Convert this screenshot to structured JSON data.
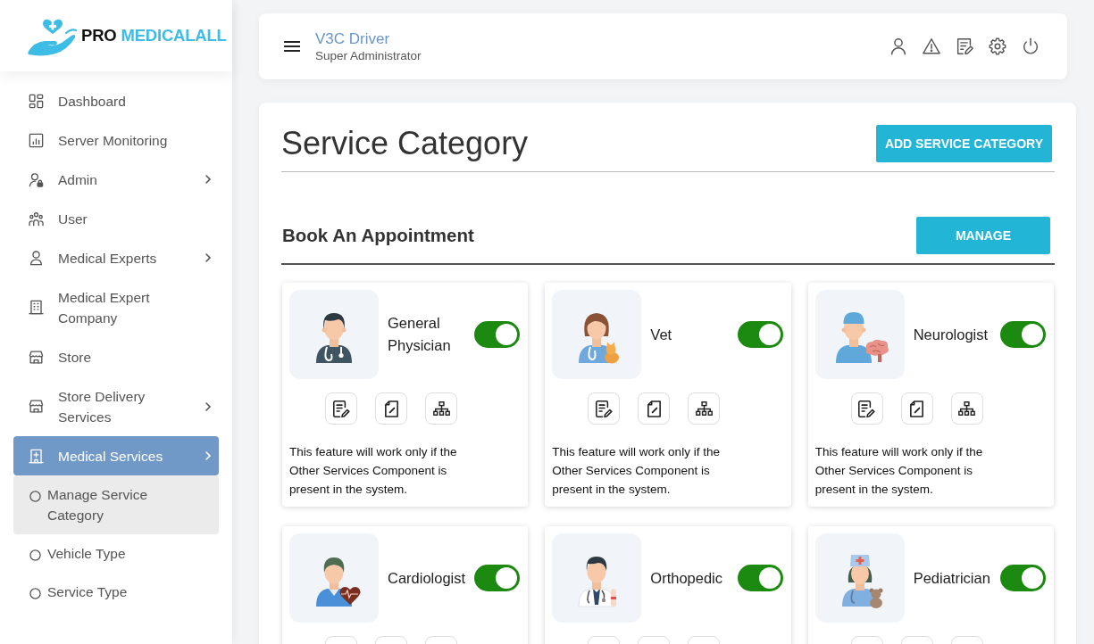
{
  "brand": {
    "prefix": "PRO",
    "name": "MEDICALALL"
  },
  "sidebar": {
    "items": [
      {
        "label": "Dashboard",
        "expandable": false,
        "selected": false
      },
      {
        "label": "Server Monitoring",
        "expandable": false,
        "selected": false
      },
      {
        "label": "Admin",
        "expandable": true,
        "selected": false
      },
      {
        "label": "User",
        "expandable": false,
        "selected": false
      },
      {
        "label": "Medical Experts",
        "expandable": true,
        "selected": false
      },
      {
        "label": "Medical Expert Company",
        "expandable": false,
        "selected": false
      },
      {
        "label": "Store",
        "expandable": false,
        "selected": false
      },
      {
        "label": "Store Delivery Services",
        "expandable": true,
        "selected": false
      },
      {
        "label": "Medical Services",
        "expandable": true,
        "selected": true,
        "children": [
          {
            "label": "Manage Service Category",
            "selected": true
          },
          {
            "label": "Vehicle Type",
            "selected": false
          },
          {
            "label": "Service Type",
            "selected": false
          }
        ]
      }
    ]
  },
  "header": {
    "user_name": "V3C Driver",
    "role": "Super Administrator"
  },
  "page": {
    "title": "Service Category",
    "add_button": "ADD SERVICE CATEGORY"
  },
  "section": {
    "title": "Book An Appointment",
    "manage_button": "MANAGE",
    "cards": [
      {
        "name": "General Physician",
        "on": true,
        "note": "This feature will work only if the Other Services Component is present in the system."
      },
      {
        "name": "Vet",
        "on": true,
        "note": "This feature will work only if the Other Services Component is present in the system."
      },
      {
        "name": "Neurologist",
        "on": true,
        "note": "This feature will work only if the Other Services Component is present in the system."
      },
      {
        "name": "Cardiologist",
        "on": true
      },
      {
        "name": "Orthopedic",
        "on": true
      },
      {
        "name": "Pediatrician",
        "on": true
      }
    ]
  }
}
